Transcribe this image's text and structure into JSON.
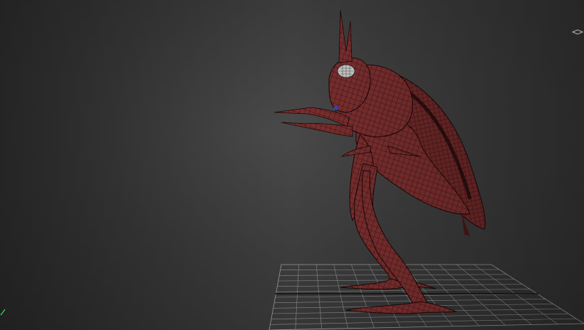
{
  "viewport": {
    "label": "",
    "background_color": "#3c3c3c",
    "grid_color": "#9a9a9a",
    "model_color": "#7a2e2e",
    "wire_color": "#2a0c0c"
  },
  "scene": {
    "object": "insect-character-mesh",
    "display_mode": "wireframe-over-shaded"
  },
  "icons": {
    "axis_gizmo": "axis-tripod-icon",
    "viewcube": "viewcube-icon"
  }
}
